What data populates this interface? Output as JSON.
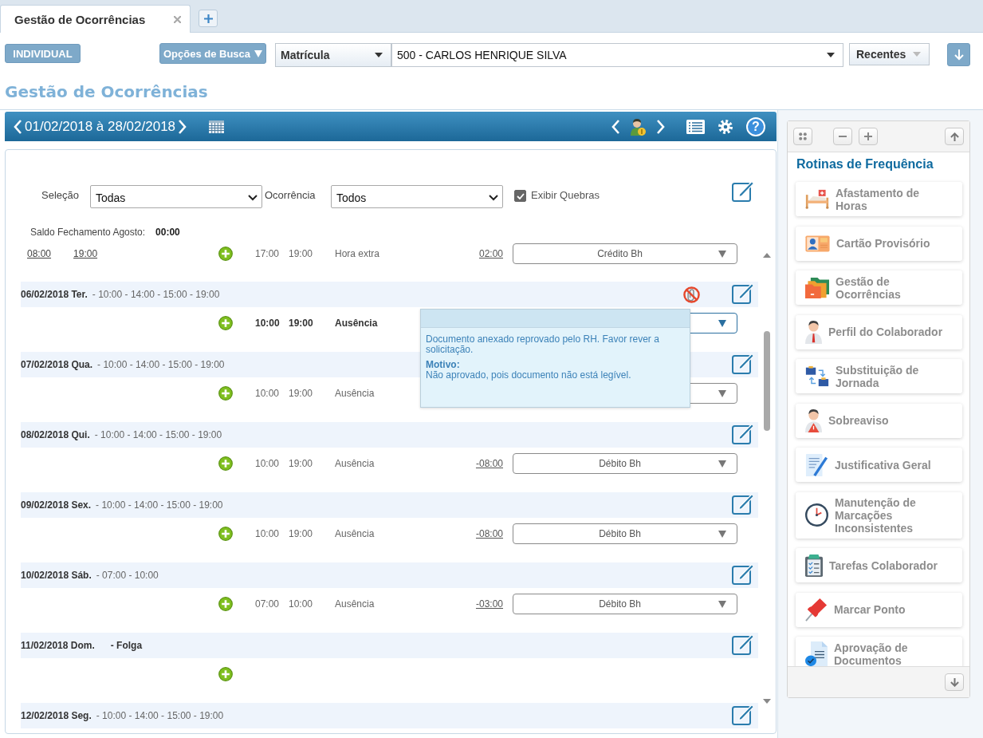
{
  "tabs": [
    {
      "label": "Gestão de Ocorrências",
      "selected": true
    }
  ],
  "toolbar": {
    "mode_button": "INDIVIDUAL",
    "search_options_button": "Opções de Busca",
    "key_select": "Matrícula",
    "employee_select": "500 - CARLOS HENRIQUE SILVA",
    "recent_select": "Recentes"
  },
  "page_title": "Gestão de Ocorrências",
  "period_bar": {
    "period": "01/02/2018 à 28/02/2018",
    "help_button": "?"
  },
  "filters": {
    "selection_label": "Seleção",
    "selection_value": "Todas",
    "occurrence_label": "Ocorrência",
    "occurrence_value": "Todos",
    "show_breaks": {
      "label": "Exibir Quebras",
      "checked": true
    }
  },
  "balance": {
    "label": "Saldo Fechamento Agosto:",
    "value": "00:00"
  },
  "days": [
    {
      "marks": [
        "08:00",
        "19:00"
      ],
      "add_button": true,
      "entries": [
        {
          "start": "17:00",
          "end": "19:00",
          "type": "Hora extra",
          "balance": "02:00",
          "classification": "Crédito Bh",
          "highlighted": false
        }
      ]
    },
    {
      "date": "06/02/2018 Ter.",
      "schedule": "- 10:00 - 14:00 - 15:00 - 19:00",
      "day_off": false,
      "document_rejected": true,
      "tooltip": {
        "message": "Documento anexado reprovado pelo RH. Favor rever a solicitação.",
        "reason_label": "Motivo:",
        "reason": "Não aprovado, pois documento não está legível."
      },
      "add_button": true,
      "entries": [
        {
          "start": "10:00",
          "end": "19:00",
          "type": "Ausência",
          "highlighted": true
        }
      ]
    },
    {
      "date": "07/02/2018 Qua.",
      "schedule": "- 10:00 - 14:00 - 15:00 - 19:00",
      "day_off": false,
      "document_rejected": false,
      "add_button": true,
      "entries": [
        {
          "start": "10:00",
          "end": "19:00",
          "type": "Ausência",
          "highlighted": false
        }
      ]
    },
    {
      "date": "08/02/2018 Qui.",
      "schedule": "- 10:00 - 14:00 - 15:00 - 19:00",
      "day_off": false,
      "document_rejected": false,
      "add_button": true,
      "entries": [
        {
          "start": "10:00",
          "end": "19:00",
          "type": "Ausência",
          "balance": "-08:00",
          "classification": "Débito Bh",
          "highlighted": false
        }
      ]
    },
    {
      "date": "09/02/2018 Sex.",
      "schedule": "- 10:00 - 14:00 - 15:00 - 19:00",
      "day_off": false,
      "document_rejected": false,
      "add_button": true,
      "entries": [
        {
          "start": "10:00",
          "end": "19:00",
          "type": "Ausência",
          "balance": "-08:00",
          "classification": "Débito Bh",
          "highlighted": false
        }
      ]
    },
    {
      "date": "10/02/2018 Sáb.",
      "schedule": "- 07:00 - 10:00",
      "day_off": false,
      "document_rejected": false,
      "add_button": true,
      "entries": [
        {
          "start": "07:00",
          "end": "10:00",
          "type": "Ausência",
          "balance": "-03:00",
          "classification": "Débito Bh",
          "highlighted": false
        }
      ]
    },
    {
      "date": "11/02/2018 Dom.",
      "schedule": "- Folga",
      "day_off": true,
      "document_rejected": false,
      "add_button": true
    },
    {
      "date": "12/02/2018 Seg.",
      "schedule": "- 10:00 - 14:00 - 15:00 - 19:00",
      "day_off": false,
      "document_rejected": false,
      "add_button": false
    }
  ],
  "sidebar": {
    "title": "Rotinas de Frequência",
    "items": [
      {
        "label": "Afastamento de Horas",
        "kind": "bed"
      },
      {
        "label": "Cartão Provisório",
        "kind": "badge"
      },
      {
        "label": "Gestão de Ocorrências",
        "kind": "folders"
      },
      {
        "label": "Perfil do Colaborador",
        "kind": "person"
      },
      {
        "label": "Substituição de Jornada",
        "kind": "swap"
      },
      {
        "label": "Sobreaviso",
        "kind": "oncall"
      },
      {
        "label": "Justificativa Geral",
        "kind": "form"
      },
      {
        "label": "Manutenção de Marcações Inconsistentes",
        "kind": "clock"
      },
      {
        "label": "Tarefas Colaborador",
        "kind": "checklist"
      },
      {
        "label": "Marcar Ponto",
        "kind": "pin"
      },
      {
        "label": "Aprovação de Documentos",
        "kind": "approval"
      }
    ]
  }
}
